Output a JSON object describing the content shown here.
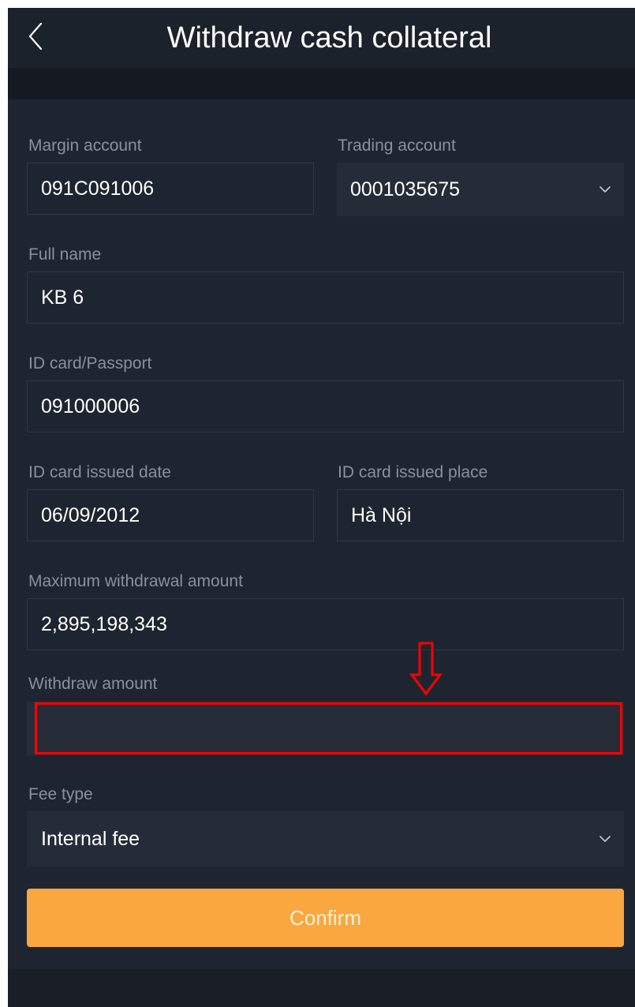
{
  "header": {
    "title": "Withdraw cash collateral",
    "back_icon": "chevron-left-icon"
  },
  "form": {
    "margin_account": {
      "label": "Margin account",
      "value": "091C091006"
    },
    "trading_account": {
      "label": "Trading account",
      "value": "0001035675",
      "icon": "chevron-down-icon"
    },
    "full_name": {
      "label": "Full name",
      "value": "KB 6"
    },
    "id_card": {
      "label": "ID card/Passport",
      "value": "091000006"
    },
    "issued_date": {
      "label": "ID card issued date",
      "value": "06/09/2012"
    },
    "issued_place": {
      "label": "ID card issued place",
      "value": "Hà Nội"
    },
    "max_amount": {
      "label": "Maximum withdrawal amount",
      "value": "2,895,198,343"
    },
    "withdraw_amount": {
      "label": "Withdraw amount",
      "value": "",
      "placeholder": ""
    },
    "fee_type": {
      "label": "Fee type",
      "value": "Internal fee",
      "icon": "chevron-down-icon"
    },
    "confirm_label": "Confirm"
  },
  "annotation": {
    "arrow_icon": "down-arrow-icon",
    "highlight_color": "#ff0000"
  },
  "colors": {
    "background": "#191e27",
    "card": "#1f2530",
    "label": "#8a909c",
    "accent": "#f9a83f"
  }
}
